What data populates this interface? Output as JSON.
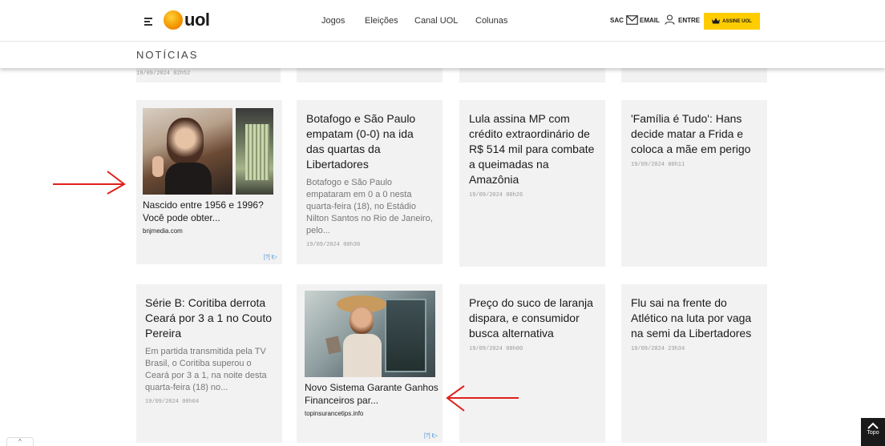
{
  "header": {
    "logo_text": "uol",
    "nav": [
      "Jogos",
      "Eleições",
      "Canal UOL",
      "Colunas"
    ],
    "sac_label": "SAC",
    "email_label": "EMAIL",
    "login_label": "ENTRE",
    "subscribe_label": "ASSINE UOL",
    "accent_color": "#ffcc00"
  },
  "section": {
    "title": "NOTÍCIAS",
    "previous_date": "19/09/2024 02h52"
  },
  "row1": {
    "ad": {
      "title": "Nascido entre 1956 e 1996? Você pode obter...",
      "source": "bnjmedia.com",
      "marker": "[?] I▷"
    },
    "cards": [
      {
        "title": "Botafogo e São Paulo empatam (0-0) na ida das quartas da Libertadores",
        "desc": "Botafogo e São Paulo empataram em 0 a 0 nesta quarta-feira (18), no Estádio Nilton Santos no Rio de Janeiro, pelo...",
        "date": "19/09/2024 00h30"
      },
      {
        "title": "Lula assina MP com crédito extraordinário de R$ 514 mil para combate a queimadas na Amazônia",
        "date": "19/09/2024 00h26"
      },
      {
        "title": "'Família é Tudo': Hans decide matar a Frida e coloca a mãe em perigo",
        "date": "19/09/2024 00h11"
      }
    ]
  },
  "row2": {
    "card0": {
      "title": "Série B: Coritiba derrota Ceará por 3 a 1 no Couto Pereira",
      "desc": "Em partida transmitida pela TV Brasil, o Coritiba superou o Ceará por 3 a 1, na noite desta quarta-feira (18) no...",
      "date": "19/09/2024 00h04"
    },
    "ad": {
      "title": "Novo Sistema Garante Ganhos Financeiros par...",
      "source": "topinsurancetips.info",
      "marker": "[?] I▷"
    },
    "cards": [
      {
        "title": "Preço do suco de laranja dispara, e consumidor busca alternativa",
        "date": "19/09/2024 00h00"
      },
      {
        "title": "Flu sai na frente do Atlético na luta por vaga na semi da Libertadores",
        "date": "18/09/2024 23h34"
      }
    ]
  },
  "topo_label": "Topo",
  "scroll_symbol": "^",
  "annotation_color": "#e0201b"
}
